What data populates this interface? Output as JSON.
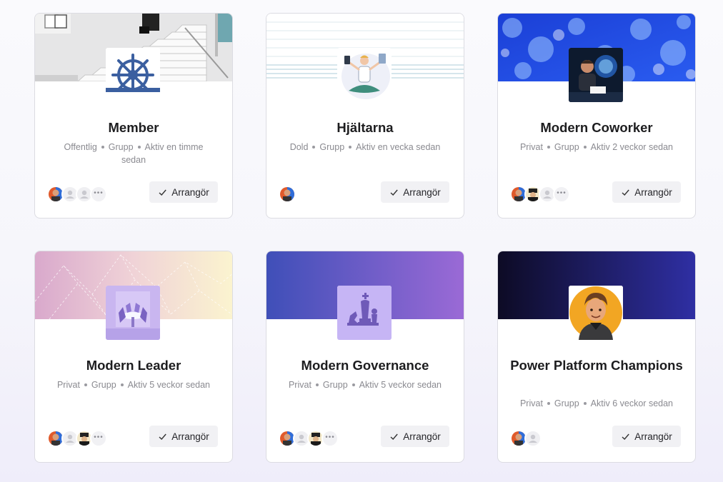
{
  "cards": [
    {
      "title": "Member",
      "visibility": "Offentlig",
      "type": "Grupp",
      "activity": "Aktiv en timme sedan",
      "button": "Arrangör",
      "logo_icon": "ship-wheel-icon",
      "banner": "staircase-photo"
    },
    {
      "title": "Hjältarna",
      "visibility": "Dold",
      "type": "Grupp",
      "activity": "Aktiv en vecka sedan",
      "button": "Arrangör",
      "logo_icon": "meditating-person-icon",
      "banner": "light-lines"
    },
    {
      "title": "Modern Coworker",
      "visibility": "Privat",
      "type": "Grupp",
      "activity": "Aktiv 2 veckor sedan",
      "button": "Arrangör",
      "logo_icon": "person-with-robot-icon",
      "banner": "blue-bokeh"
    },
    {
      "title": "Modern Leader",
      "visibility": "Privat",
      "type": "Grupp",
      "activity": "Aktiv 5 veckor sedan",
      "button": "Arrangör",
      "logo_icon": "meeting-table-icon",
      "banner": "pastel-geometric"
    },
    {
      "title": "Modern Governance",
      "visibility": "Privat",
      "type": "Grupp",
      "activity": "Aktiv 5 veckor sedan",
      "button": "Arrangör",
      "logo_icon": "chess-pieces-icon",
      "banner": "blue-purple-gradient"
    },
    {
      "title": "Power Platform Champions",
      "visibility": "Privat",
      "type": "Grupp",
      "activity": "Aktiv 6 veckor sedan",
      "button": "Arrangör",
      "logo_icon": "cartoon-avatar-icon",
      "banner": "dark-navy-gradient"
    }
  ],
  "colors": {
    "title": "#1d1d1f",
    "meta": "#8a8a90",
    "button_bg": "#f1f1f4"
  }
}
